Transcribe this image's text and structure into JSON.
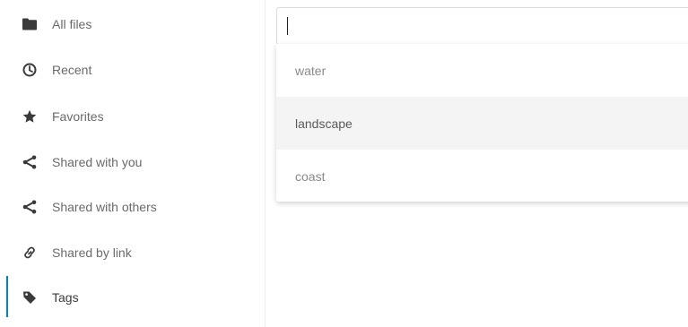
{
  "sidebar": {
    "items": [
      {
        "label": "All files",
        "icon": "folder-icon"
      },
      {
        "label": "Recent",
        "icon": "clock-icon"
      },
      {
        "label": "Favorites",
        "icon": "star-icon"
      },
      {
        "label": "Shared with you",
        "icon": "share-icon"
      },
      {
        "label": "Shared with others",
        "icon": "share-icon"
      },
      {
        "label": "Shared by link",
        "icon": "link-icon"
      },
      {
        "label": "Tags",
        "icon": "tag-icon",
        "active": true
      }
    ]
  },
  "tag_search": {
    "value": "",
    "options": [
      {
        "label": "water"
      },
      {
        "label": "landscape",
        "highlighted": true
      },
      {
        "label": "coast"
      }
    ]
  },
  "colors": {
    "accent": "#0082c9",
    "highlight_bg": "#f4f4f4",
    "icon": "#3a3a3a"
  }
}
